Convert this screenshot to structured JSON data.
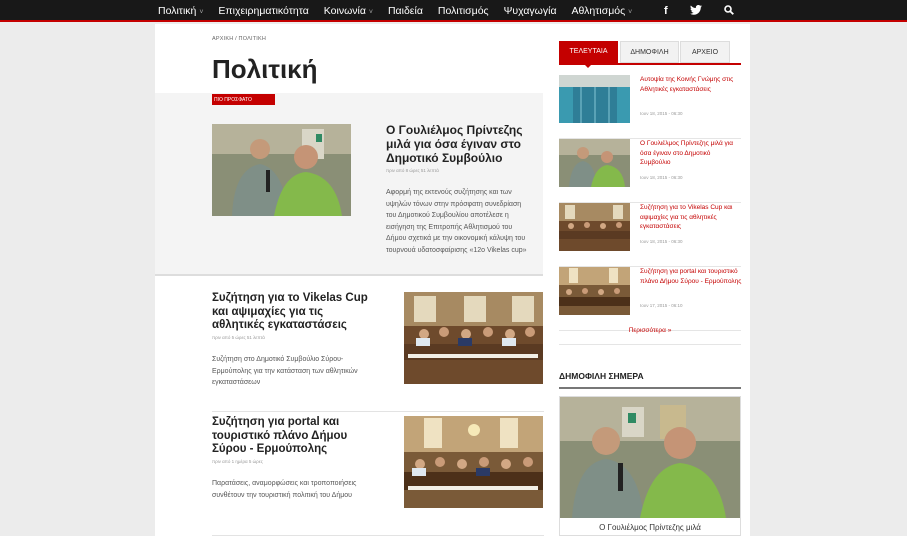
{
  "nav": {
    "items": [
      {
        "label": "Πολιτική",
        "caret": "˅"
      },
      {
        "label": "Επιχειρηματικότητα",
        "caret": ""
      },
      {
        "label": "Κοινωνία",
        "caret": "˅"
      },
      {
        "label": "Παιδεία",
        "caret": ""
      },
      {
        "label": "Πολιτισμός",
        "caret": ""
      },
      {
        "label": "Ψυχαγωγία",
        "caret": ""
      },
      {
        "label": "Αθλητισμός",
        "caret": "˅"
      }
    ],
    "facebook": "f",
    "twitter": "twitter-bird",
    "search": "search"
  },
  "breadcrumb": "ΑΡΧΙΚΗ / ΠΟΛΙΤΙΚΗ",
  "page_title": "Πολιτική",
  "featured": {
    "badge": "ΠΙΟ ΠΡΟΣΦΑΤΟ",
    "title": "Ο Γουλιέλμος Πρίντεζης μιλά για όσα έγιναν στο Δημοτικό Συμβούλιο",
    "meta": "πριν από 8 ώρες 51 λεπτά",
    "excerpt": "Αφορμή της εκτενούς συζήτησης και των υψηλών τόνων στην πρόσφατη συνεδρίαση του Δημοτικού Συμβουλίου αποτέλεσε η εισήγηση της Επιτροπής Αθλητισμού του Δήμου σχετικά με την οικονομική κάλυψη του τουρνουά υδατοσφαίρισης «12ο Vikelas cup»"
  },
  "articles": [
    {
      "title": "Συζήτηση για το Vikelas Cup και αψιμαχίες για τις αθλητικές εγκαταστάσεις",
      "meta": "πριν από 5 ώρες 51 λεπτά",
      "excerpt": "Συζήτηση στο Δημοτικό Συμβούλιο Σύρου-Ερμούπολης για την κατάσταση των αθλητικών εγκαταστάσεων"
    },
    {
      "title": "Συζήτηση για portal και τουριστικό πλάνο Δήμου Σύρου - Ερμούπολης",
      "meta": "πριν από 1 ημέρα 5 ώρες",
      "excerpt": "Παρατάσεις, αναμορφώσεις και τροποποιήσεις συνθέτουν την τουριστική πολιτική του Δήμου"
    }
  ],
  "sidebar": {
    "tabs": [
      "ΤΕΛΕΥΤΑΙΑ",
      "ΔΗΜΟΦΙΛΗ",
      "ΑΡΧΕΙΟ"
    ],
    "items": [
      {
        "title": "Αυτοψία της Κοινής Γνώμης στις Αθλητικές εγκαταστάσεις",
        "meta": "Ιουν 18, 2015 - 06:30"
      },
      {
        "title": "Ο Γουλιέλμος Πρίντεζης μιλά για όσα έγιναν στο Δημοτικό Συμβούλιο",
        "meta": "Ιουν 18, 2015 - 06:30"
      },
      {
        "title": "Συζήτηση για το Vikelas Cup και αψιμαχίες για τις αθλητικές εγκαταστάσεις",
        "meta": "Ιουν 18, 2015 - 06:30"
      },
      {
        "title": "Συζήτηση για portal και τουριστικό πλάνο Δήμου Σύρου - Ερμούπολης",
        "meta": "Ιουν 17, 2015 - 06:10"
      }
    ],
    "more": "Περισσότερα »",
    "popular_heading": "ΔΗΜΟΦΙΛΗ ΣΗΜΕΡΑ",
    "popular_title": "Ο Γουλιέλμος Πρίντεζης μιλά"
  },
  "colors": {
    "accent": "#c40000",
    "nav_bg": "#181818"
  }
}
